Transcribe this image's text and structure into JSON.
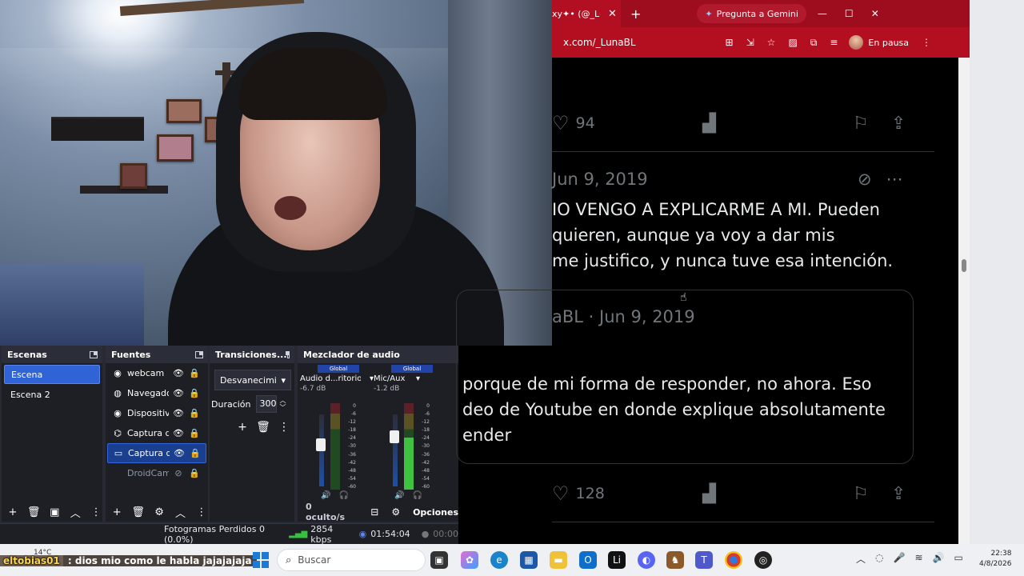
{
  "obs": {
    "scenes": {
      "title": "Escenas",
      "items": [
        "Escena",
        "Escena 2"
      ]
    },
    "sources": {
      "title": "Fuentes",
      "items": [
        "webcam",
        "Navegado",
        "Dispositiv",
        "Captura d",
        "Captura d",
        "DroidCam"
      ]
    },
    "transitions": {
      "title": "Transiciones...",
      "selected": "Desvanecimi",
      "duration_label": "Duración",
      "duration_value": "300"
    },
    "mixer": {
      "title": "Mezclador de audio",
      "channels": [
        {
          "global": "Global",
          "name": "Audio d...ritorio",
          "db": "-6.7 dB",
          "level": 0.0
        },
        {
          "global": "Global",
          "name": "Mic/Aux",
          "db": "-1.2 dB",
          "level": 0.6
        }
      ],
      "scale": [
        "0",
        "-6",
        "-12",
        "-18",
        "-24",
        "-30",
        "-36",
        "-42",
        "-48",
        "-54",
        "-60"
      ],
      "hidden": "0 oculto/s",
      "options": "Opciones"
    },
    "status": {
      "dropped": "Fotogramas Perdidos 0 (0.0%)",
      "kbps": "2854 kbps",
      "stream_time": "01:54:04",
      "rec_time": "00:00"
    }
  },
  "browser": {
    "tab_title": "xy✦• (@_Lun",
    "gemini": "Pregunta a Gemini",
    "url": "x.com/_LunaBL",
    "profile": "En pausa",
    "likes1": "94",
    "date1": "Jun 9, 2019",
    "tweet_lines": [
      "IO VENGO A EXPLICARME A MI. Pueden",
      "quieren, aunque ya voy a dar mis",
      "me justifico, y nunca tuve esa intención."
    ],
    "quote_meta": "aBL · Jun 9, 2019",
    "quote_lines": [
      "porque de mi forma de responder, no ahora. Eso",
      "deo de Youtube en donde explique absolutamente",
      "ender"
    ],
    "likes2": "128"
  },
  "taskbar": {
    "chat_user": "eltobias01",
    "chat_msg": ": dios mio como le habla jajajajaja",
    "temp": "14°C",
    "search_placeholder": "Buscar",
    "time": "22:38",
    "date": "4/8/2026"
  },
  "colors": {
    "browser_accent": "#9e0d1e",
    "obs_selected": "#2f63d6",
    "meter_green": "#3fc23f"
  }
}
